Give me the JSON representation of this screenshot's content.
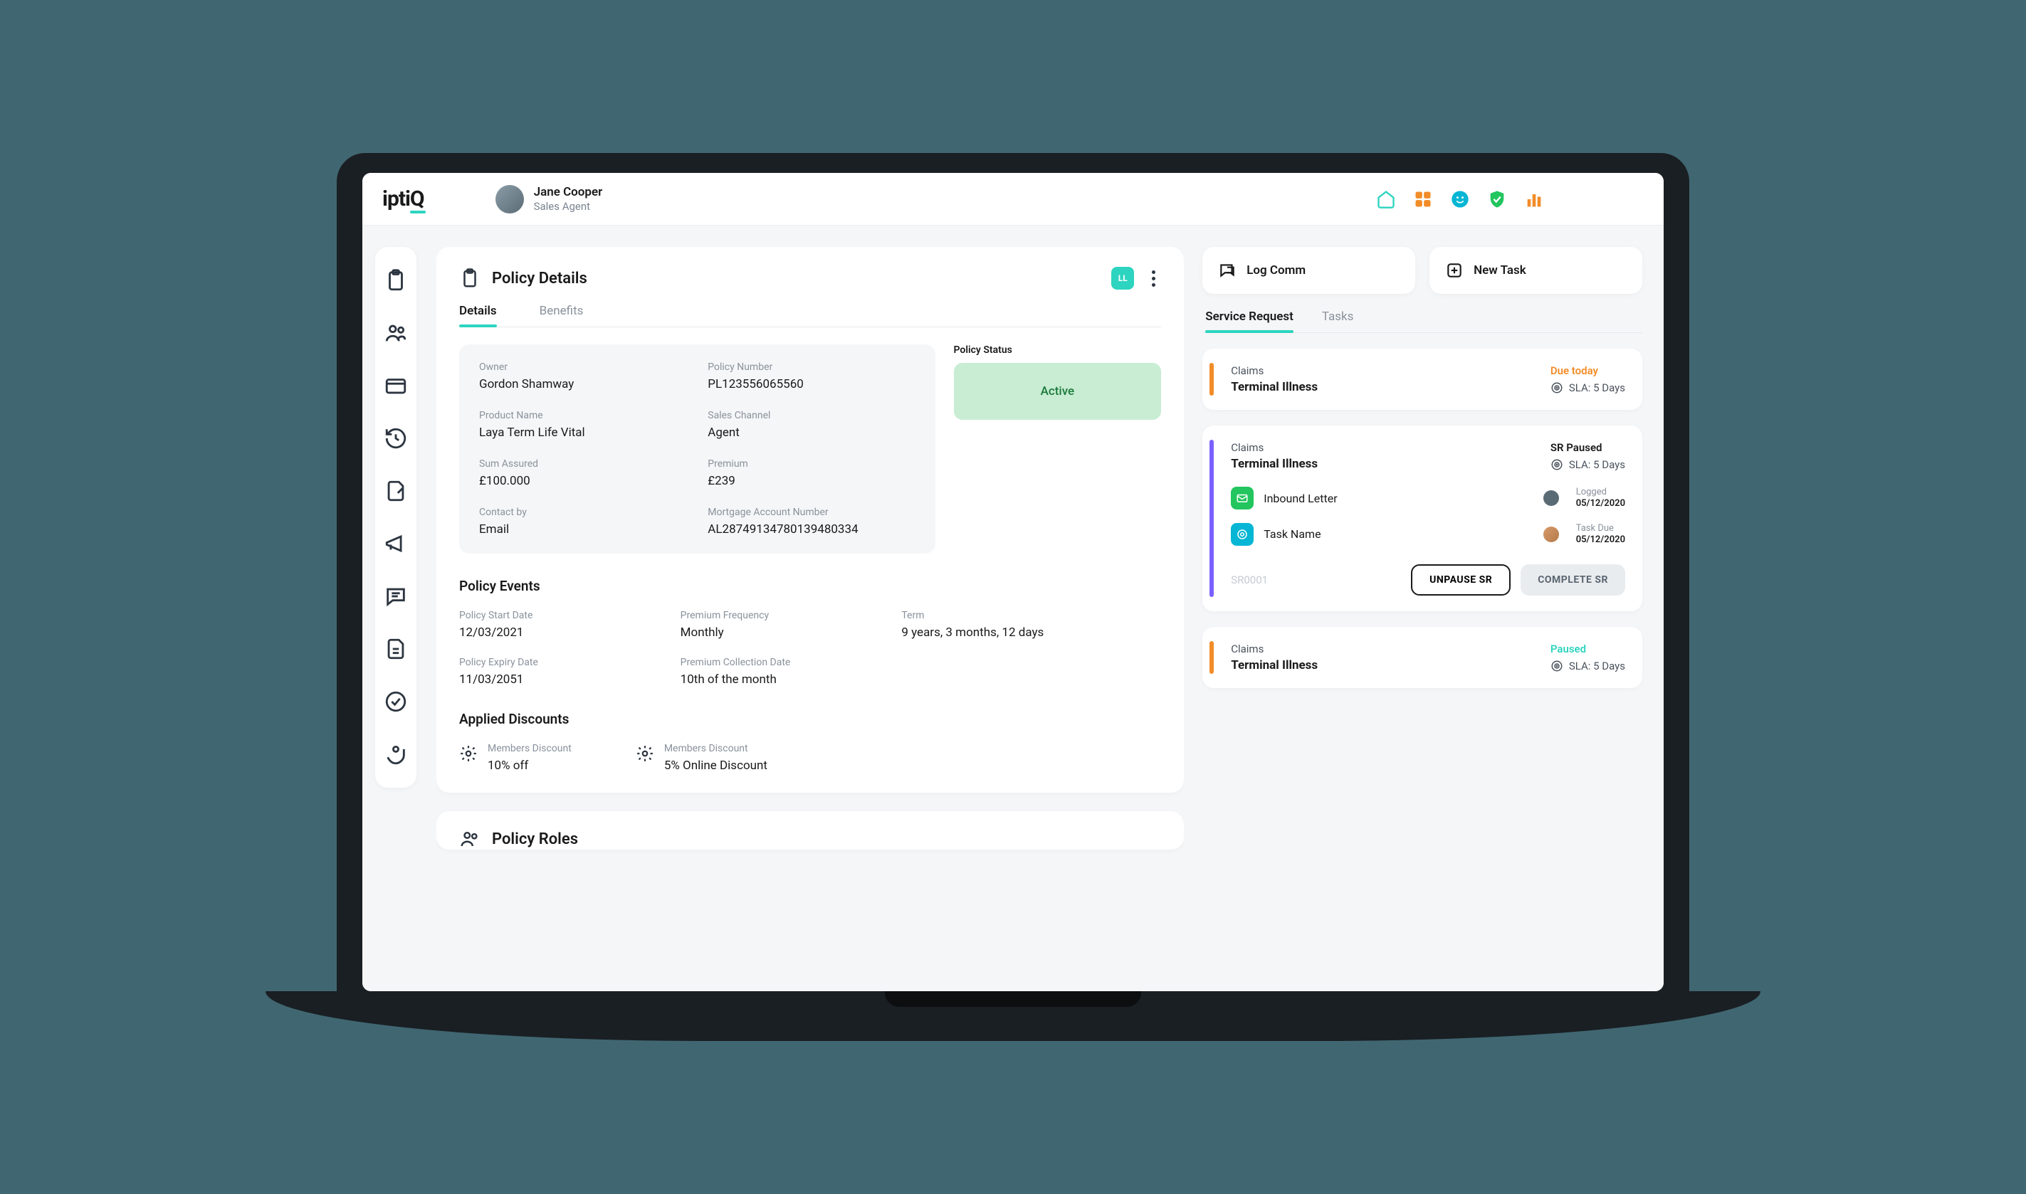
{
  "brand": "iptiQ",
  "user": {
    "name": "Jane Cooper",
    "role": "Sales Agent"
  },
  "policy_details": {
    "title": "Policy Details",
    "hex": "LL",
    "tabs": {
      "details": "Details",
      "benefits": "Benefits"
    },
    "fields": {
      "owner_label": "Owner",
      "owner": "Gordon Shamway",
      "policy_number_label": "Policy Number",
      "policy_number": "PL123556065560",
      "product_name_label": "Product Name",
      "product_name": "Laya Term Life Vital",
      "sales_channel_label": "Sales Channel",
      "sales_channel": "Agent",
      "sum_assured_label": "Sum Assured",
      "sum_assured": "£100.000",
      "premium_label": "Premium",
      "premium": "£239",
      "contact_by_label": "Contact by",
      "contact_by": "Email",
      "mortgage_label": "Mortgage Account Number",
      "mortgage": "AL28749134780139480334"
    },
    "status_label": "Policy Status",
    "status": "Active",
    "events": {
      "title": "Policy Events",
      "start_label": "Policy Start Date",
      "start": "12/03/2021",
      "freq_label": "Premium Frequency",
      "freq": "Monthly",
      "term_label": "Term",
      "term": "9 years, 3 months, 12 days",
      "expiry_label": "Policy Expiry Date",
      "expiry": "11/03/2051",
      "collection_label": "Premium Collection Date",
      "collection": "10th of the month"
    },
    "discounts": {
      "title": "Applied Discounts",
      "d1_label": "Members Discount",
      "d1": "10% off",
      "d2_label": "Members Discount",
      "d2": "5% Online Discount"
    }
  },
  "roles_title": "Policy Roles",
  "actions": {
    "log_comm": "Log Comm",
    "new_task": "New Task"
  },
  "side_tabs": {
    "service_request": "Service Request",
    "tasks": "Tasks"
  },
  "srs": [
    {
      "color": "orange",
      "category": "Claims",
      "title": "Terminal Illness",
      "status_text": "Due today",
      "status_class": "orange",
      "sla": "SLA: 5 Days"
    },
    {
      "color": "purple",
      "category": "Claims",
      "title": "Terminal Illness",
      "status_text": "SR Paused",
      "status_class": "dark",
      "sla": "SLA: 5 Days",
      "tasks": [
        {
          "chip": "green",
          "icon": "mail",
          "name": "Inbound Letter",
          "meta_label": "Logged",
          "meta_val": "05/12/2020"
        },
        {
          "chip": "blue",
          "icon": "target",
          "name": "Task Name",
          "meta_label": "Task Due",
          "meta_val": "05/12/2020"
        }
      ],
      "sr_id": "SR0001",
      "btn_unpause": "UNPAUSE SR",
      "btn_complete": "COMPLETE SR"
    },
    {
      "color": "orange",
      "category": "Claims",
      "title": "Terminal Illness",
      "status_text": "Paused",
      "status_class": "teal",
      "sla": "SLA: 5 Days"
    }
  ]
}
